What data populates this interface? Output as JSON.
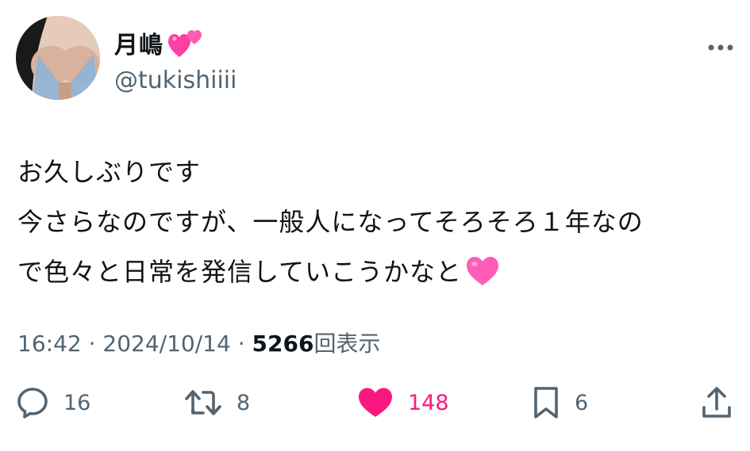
{
  "author": {
    "display_name": "月嶋",
    "name_emoji": "two-hearts-emoji",
    "handle": "@tukishiiii"
  },
  "post": {
    "lines": [
      "お久しぶりです",
      "今さらなのですが、一般人になってそろそろ１年なの",
      "で色々と日常を発信していこうかなと"
    ],
    "trailing_emoji": "pink-heart-emoji"
  },
  "meta": {
    "time": "16:42",
    "separator": " · ",
    "date": "2024/10/14",
    "views_count": "5266",
    "views_label": "回表示"
  },
  "actions": {
    "replies": "16",
    "reposts": "8",
    "likes": "148",
    "bookmarks": "6"
  },
  "colors": {
    "text_primary": "#0f1419",
    "text_secondary": "#536471",
    "like_active": "#f91880"
  }
}
